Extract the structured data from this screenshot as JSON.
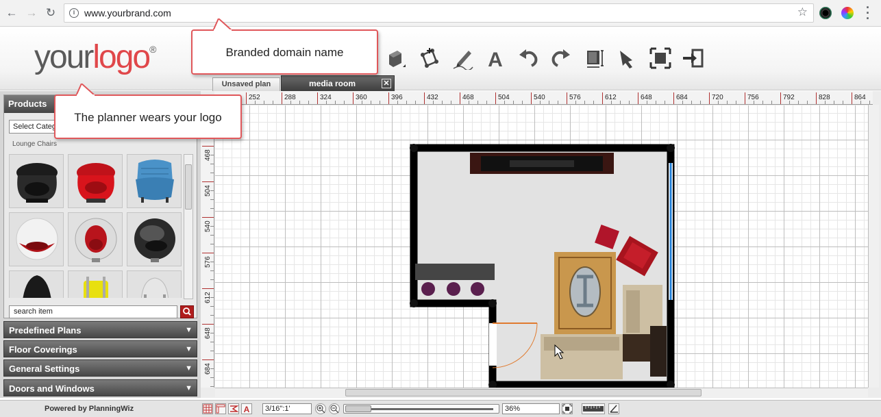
{
  "browser": {
    "url": "www.yourbrand.com"
  },
  "header": {
    "logo_your": "your",
    "logo_logo": "logo",
    "logo_reg": "®"
  },
  "tabs": [
    {
      "label": "Unsaved plan"
    },
    {
      "label": "media room"
    }
  ],
  "tab_close": "✕",
  "products": {
    "title": "Products",
    "select_value": "Select Categ",
    "category_label": "Lounge Chairs",
    "search_value": "search item"
  },
  "accordion": [
    {
      "label": "Predefined Plans"
    },
    {
      "label": "Floor Coverings"
    },
    {
      "label": "General Settings"
    },
    {
      "label": "Doors and Windows"
    }
  ],
  "ruler": {
    "top": [
      "252",
      "288",
      "324",
      "360",
      "396",
      "432",
      "468",
      "504",
      "540",
      "576",
      "612",
      "648",
      "684",
      "720",
      "756",
      "792",
      "828",
      "864"
    ],
    "left": [
      "468",
      "504",
      "540",
      "576",
      "612",
      "648",
      "684"
    ]
  },
  "status": {
    "powered_by": "Powered by PlanningWiz",
    "scale": "3/16\":1'",
    "zoom": "36%"
  },
  "callouts": {
    "domain": "Branded domain name",
    "logo": "The planner wears your logo"
  },
  "colors": {
    "accent_red": "#e0474a",
    "wall": "#000000",
    "door_swing": "#e07a2e",
    "window_blue": "#1f7ed6",
    "chair_red": "#b0152a"
  }
}
